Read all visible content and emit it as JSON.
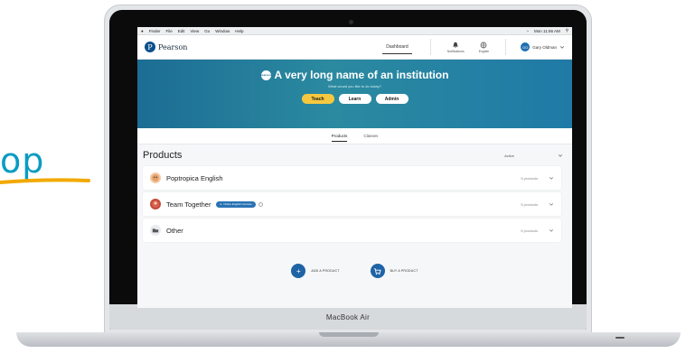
{
  "brand_fragment": "op",
  "laptop": {
    "model_label": "MacBook Air"
  },
  "menubar": {
    "items": [
      "Finder",
      "File",
      "Edit",
      "View",
      "Go",
      "Window",
      "Help"
    ],
    "clock": "Mon 11:56 AM"
  },
  "appbar": {
    "logo_text": "Pearson",
    "nav_dashboard": "Dashboard",
    "notifications_label": "Notifications",
    "language_label": "English",
    "user_initials": "GO",
    "user_name": "Gary Oldman"
  },
  "hero": {
    "badge_text": "pearson",
    "title": "A very long name of an institution",
    "subtitle": "What would you like to do today?",
    "buttons": [
      {
        "label": "Teach",
        "active": true
      },
      {
        "label": "Learn",
        "active": false
      },
      {
        "label": "Admin",
        "active": false
      }
    ]
  },
  "tabs": [
    {
      "label": "Products",
      "active": true
    },
    {
      "label": "Classes",
      "active": false
    }
  ],
  "products": {
    "title": "Products",
    "filter_value": "Active",
    "rows": [
      {
        "label": "Poptropica English",
        "count": "5 products",
        "badge": ""
      },
      {
        "label": "Team Together",
        "count": "5 products",
        "badge": "Online English Courses"
      },
      {
        "label": "Other",
        "count": "5 products",
        "badge": ""
      }
    ]
  },
  "actions": {
    "add_product": "ADD A PRODUCT",
    "buy_product": "BUY A PRODUCT"
  },
  "colors": {
    "hero_start": "#1c6d94",
    "teach_active": "#f6c83f",
    "action_blue": "#1e63a6",
    "brand_text": "#0a9cc2"
  }
}
